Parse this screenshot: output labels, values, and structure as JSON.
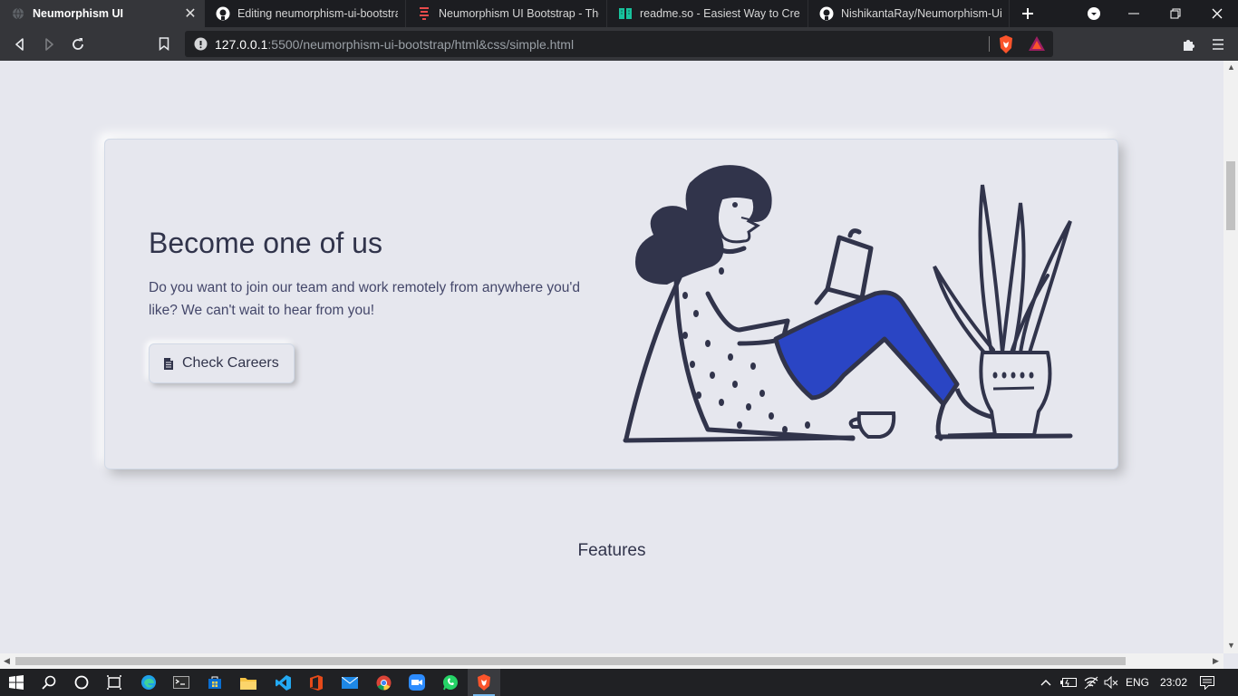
{
  "browser": {
    "tabs": [
      {
        "label": "Neumorphism UI",
        "active": true
      },
      {
        "label": "Editing neumorphism-ui-bootstrap",
        "active": false
      },
      {
        "label": "Neumorphism UI Bootstrap - Them",
        "active": false
      },
      {
        "label": "readme.so - Easiest Way to Create",
        "active": false
      },
      {
        "label": "NishikantaRay/Neumorphism-Ui-te",
        "active": false
      }
    ],
    "url_host": "127.0.0.1",
    "url_path": ":5500/neumorphism-ui-bootstrap/html&css/simple.html"
  },
  "page": {
    "card": {
      "title": "Become one of us",
      "text": "Do you want to join our team and work remotely from anywhere you'd like? We can't wait to hear from you!",
      "button_label": "Check Careers"
    },
    "features_heading": "Features"
  },
  "taskbar": {
    "language": "ENG",
    "time": "23:02"
  },
  "colors": {
    "page_background": "#e6e7ee",
    "text_dark": "#31344b",
    "text_body": "#44476a",
    "illustration_ink": "#31344b",
    "illustration_blue": "#2a45c4",
    "tab_strip": "#1c1d21",
    "toolbar": "#35363a"
  }
}
